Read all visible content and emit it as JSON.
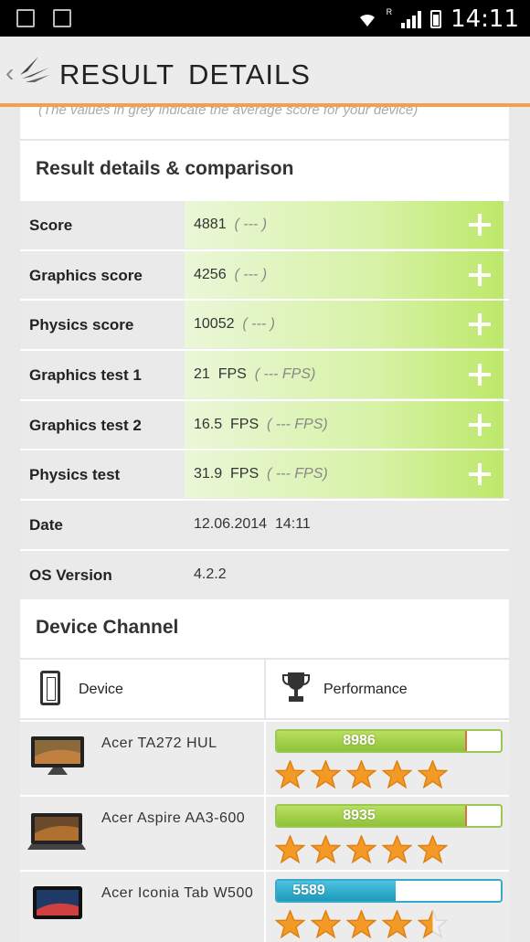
{
  "status_bar": {
    "time": "14:11",
    "roaming_indicator": "R"
  },
  "header": {
    "title": "RESULT DETAILS",
    "back_icon": "chevron-left-icon",
    "logo_icon": "3dmark-logo-icon"
  },
  "note": "(The values in grey indicate the average score for your device)",
  "comparison": {
    "title": "Result details & comparison",
    "rows": [
      {
        "label": "Score",
        "value": "4881  ",
        "avg": "( --- )",
        "expandable": true
      },
      {
        "label": "Graphics score",
        "value": "4256  ",
        "avg": "( --- )",
        "expandable": true
      },
      {
        "label": "Physics score",
        "value": "10052  ",
        "avg": "( --- )",
        "expandable": true
      },
      {
        "label": "Graphics test 1",
        "value": "21  FPS  ",
        "avg": "( --- FPS)",
        "expandable": true
      },
      {
        "label": "Graphics test 2",
        "value": "16.5  FPS  ",
        "avg": "( --- FPS)",
        "expandable": true
      },
      {
        "label": "Physics test",
        "value": "31.9  FPS  ",
        "avg": "( --- FPS)",
        "expandable": true
      },
      {
        "label": "Date",
        "value": "12.06.2014  14:11",
        "avg": "",
        "expandable": false
      },
      {
        "label": "OS Version",
        "value": "4.2.2",
        "avg": "",
        "expandable": false
      }
    ]
  },
  "device_channel": {
    "title": "Device Channel",
    "col_device": "Device",
    "col_performance": "Performance",
    "devices": [
      {
        "name": "Acer  TA272  HUL",
        "score": "8986",
        "fill_fraction": 0.85,
        "stars": 5,
        "color": "#8fc23a"
      },
      {
        "name": "Acer  Aspire  AA3-600",
        "score": "8935",
        "fill_fraction": 0.85,
        "stars": 5,
        "color": "#8fc23a"
      },
      {
        "name": "Acer  Iconia  Tab  W500",
        "score": "5589",
        "fill_fraction": 0.53,
        "stars": 4.5,
        "color": "#1e9abb"
      }
    ]
  },
  "colors": {
    "accent": "#f0a050",
    "green": "#8fc23a",
    "blue": "#1e9abb",
    "star": "#f39a26"
  }
}
